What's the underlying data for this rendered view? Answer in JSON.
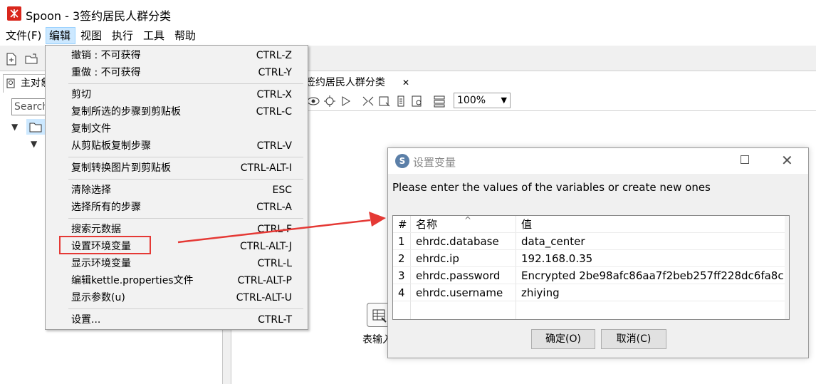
{
  "window": {
    "title": "Spoon - 3签约居民人群分类"
  },
  "menubar": {
    "items": [
      {
        "label": "文件(F)"
      },
      {
        "label": "编辑"
      },
      {
        "label": "视图"
      },
      {
        "label": "执行"
      },
      {
        "label": "工具"
      },
      {
        "label": "帮助"
      }
    ]
  },
  "left_panel": {
    "tab_label": "主对象",
    "search_placeholder": "Search"
  },
  "editor": {
    "tab_label": "3签约居民人群分类",
    "zoom": "100%",
    "step_label": "表输入"
  },
  "edit_menu": {
    "items": [
      {
        "label": "撤销 : 不可获得",
        "shortcut": "CTRL-Z"
      },
      {
        "label": "重做 : 不可获得",
        "shortcut": "CTRL-Y"
      },
      {
        "label": "剪切",
        "shortcut": "CTRL-X"
      },
      {
        "label": "复制所选的步骤到剪贴板",
        "shortcut": "CTRL-C"
      },
      {
        "label": "复制文件",
        "shortcut": ""
      },
      {
        "label": "从剪贴板复制步骤",
        "shortcut": "CTRL-V"
      },
      {
        "label": "复制转换图片到剪贴板",
        "shortcut": "CTRL-ALT-I"
      },
      {
        "label": "清除选择",
        "shortcut": "ESC"
      },
      {
        "label": "选择所有的步骤",
        "shortcut": "CTRL-A"
      },
      {
        "label": "搜索元数据",
        "shortcut": "CTRL-F"
      },
      {
        "label": "设置环境变量",
        "shortcut": "CTRL-ALT-J"
      },
      {
        "label": "显示环境变量",
        "shortcut": "CTRL-L"
      },
      {
        "label": "编辑kettle.properties文件",
        "shortcut": "CTRL-ALT-P"
      },
      {
        "label": "显示参数(u)",
        "shortcut": "CTRL-ALT-U"
      },
      {
        "label": "设置...",
        "shortcut": "CTRL-T"
      }
    ]
  },
  "dialog": {
    "title": "设置变量",
    "message": "Please enter the values of the variables or create new ones",
    "columns": [
      "#",
      "名称",
      "值"
    ],
    "rows": [
      {
        "num": "1",
        "name": "ehrdc.database",
        "value": "data_center"
      },
      {
        "num": "2",
        "name": "ehrdc.ip",
        "value": "192.168.0.35"
      },
      {
        "num": "3",
        "name": "ehrdc.password",
        "value": "Encrypted 2be98afc86aa7f2beb257ff228dc6fa8c"
      },
      {
        "num": "4",
        "name": "ehrdc.username",
        "value": "zhiying"
      }
    ],
    "ok_label": "确定(O)",
    "cancel_label": "取消(C)"
  },
  "colors": {
    "highlight_red": "#e53935",
    "menu_active": "#cce8ff",
    "app_icon": "#d9261c"
  }
}
